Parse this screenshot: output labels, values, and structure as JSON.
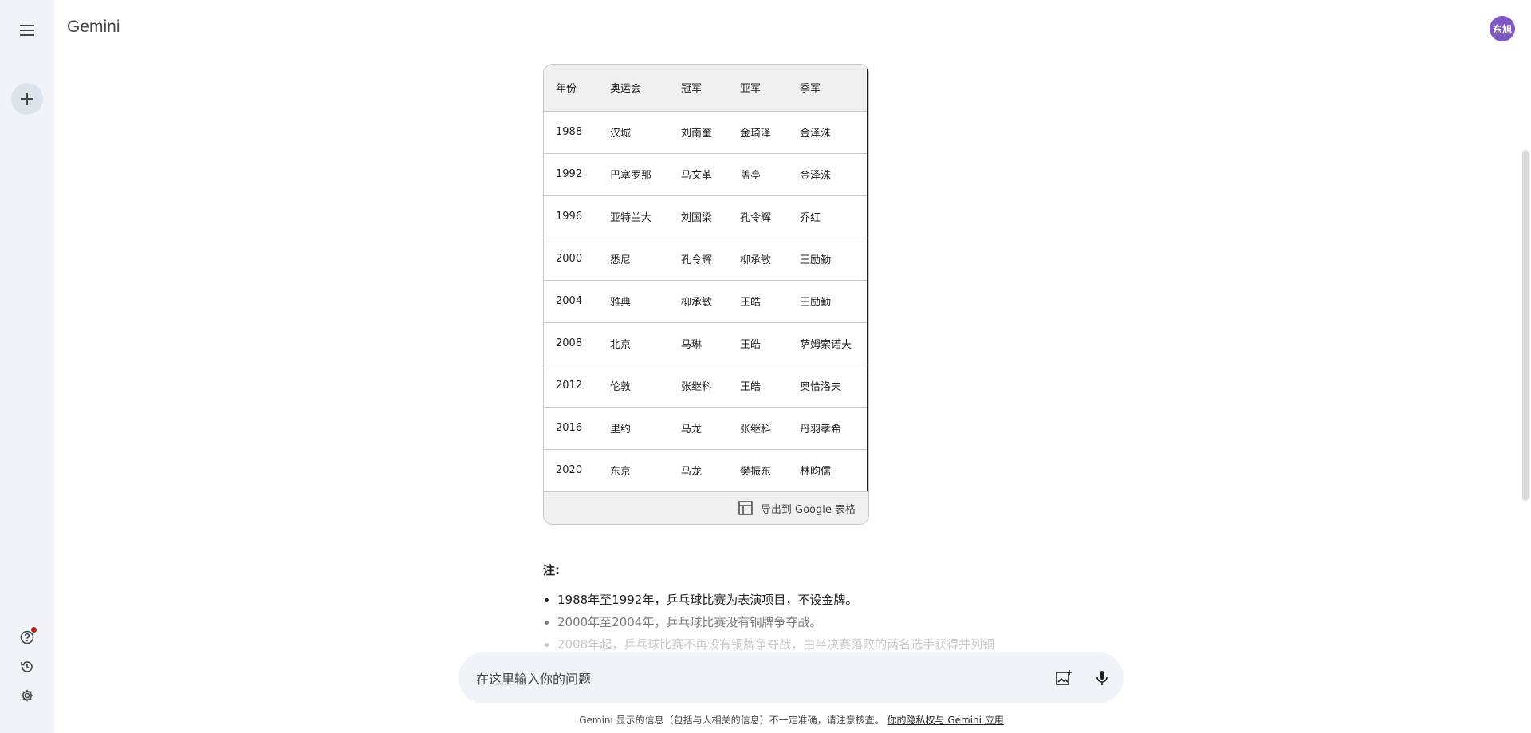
{
  "app": {
    "title": "Gemini",
    "avatar_text": "东旭"
  },
  "colors": {
    "rail_bg": "#f0f4f9",
    "avatar_bg": "#7e57c2",
    "notify_dot": "#b3261e"
  },
  "icons": {
    "menu": "menu-icon",
    "new_chat": "plus-icon",
    "help": "help-icon",
    "activity": "history-icon",
    "settings": "gear-icon",
    "image": "add-image-icon",
    "mic": "mic-icon",
    "sheets": "table-icon"
  },
  "table": {
    "headers": [
      "年份",
      "奥运会",
      "冠军",
      "亚军",
      "季军"
    ],
    "rows": [
      [
        "1988",
        "汉城",
        "刘南奎",
        "金琦泽",
        "金泽洙"
      ],
      [
        "1992",
        "巴塞罗那",
        "马文革",
        "盖亭",
        "金泽洙"
      ],
      [
        "1996",
        "亚特兰大",
        "刘国梁",
        "孔令辉",
        "乔红"
      ],
      [
        "2000",
        "悉尼",
        "孔令辉",
        "柳承敏",
        "王励勤"
      ],
      [
        "2004",
        "雅典",
        "柳承敏",
        "王皓",
        "王励勤"
      ],
      [
        "2008",
        "北京",
        "马琳",
        "王皓",
        "萨姆索诺夫"
      ],
      [
        "2012",
        "伦敦",
        "张继科",
        "王皓",
        "奥恰洛夫"
      ],
      [
        "2016",
        "里约",
        "马龙",
        "张继科",
        "丹羽孝希"
      ],
      [
        "2020",
        "东京",
        "马龙",
        "樊振东",
        "林昀儒"
      ]
    ],
    "export_label": "导出到 Google 表格"
  },
  "notes": {
    "title": "注:",
    "items": [
      "1988年至1992年，乒乓球比赛为表演项目，不设金牌。",
      "2000年至2004年，乒乓球比赛没有铜牌争夺战。",
      "2008年起，乒乓球比赛不再设有铜牌争夺战，由半决赛落败的两名选手获得并列铜"
    ]
  },
  "composer": {
    "placeholder": "在这里输入你的问题",
    "value": ""
  },
  "footer": {
    "disclaimer": "Gemini 显示的信息（包括与人相关的信息）不一定准确，请注意核查。",
    "link": "你的隐私权与 Gemini 应用"
  }
}
